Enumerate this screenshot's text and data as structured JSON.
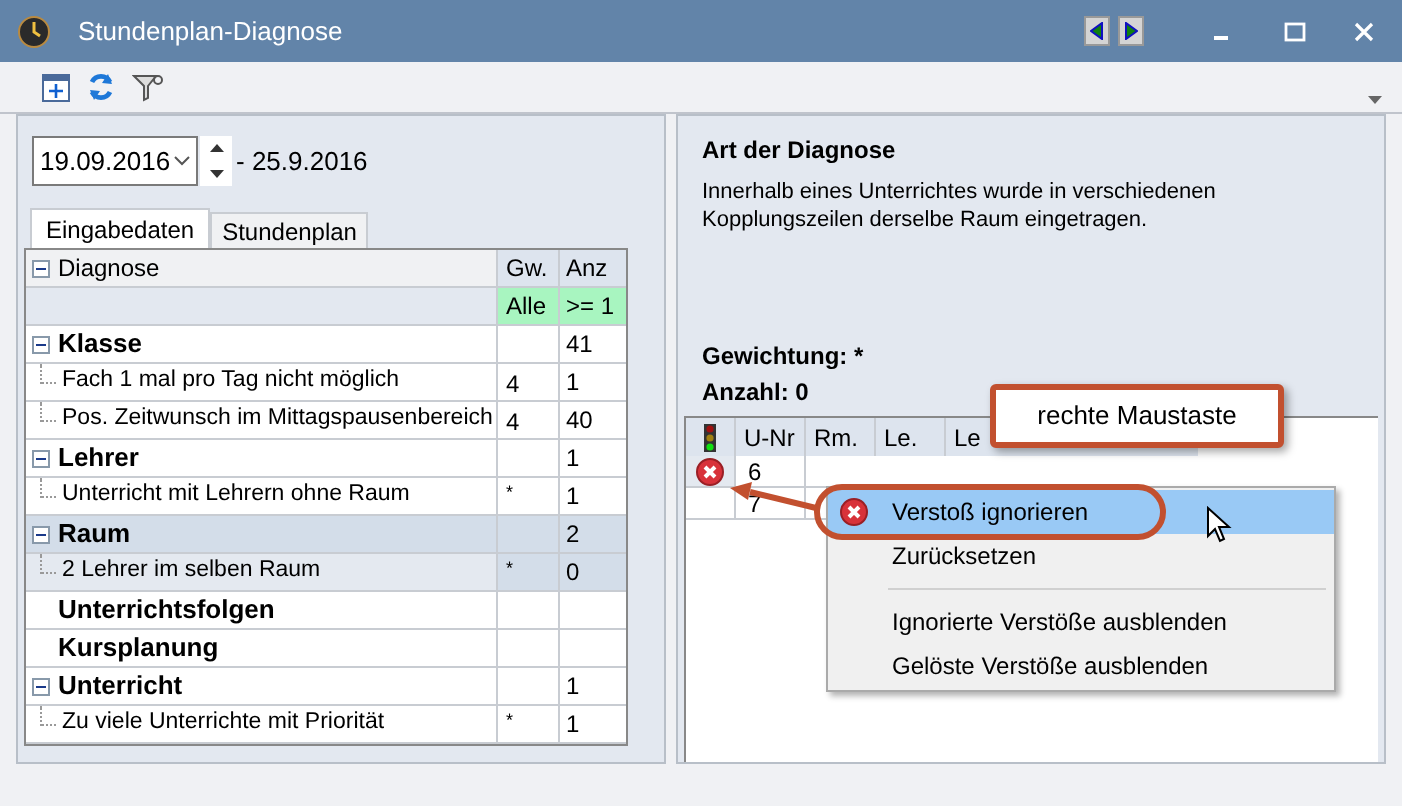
{
  "window": {
    "title": "Stundenplan-Diagnose"
  },
  "date": {
    "value": "19.09.2016",
    "range_end": "- 25.9.2016"
  },
  "tabs": [
    {
      "label": "Eingabedaten",
      "selected": true
    },
    {
      "label": "Stundenplan",
      "selected": false
    }
  ],
  "diagnosis_table": {
    "columns": [
      "Diagnose",
      "Gw.",
      "Anz"
    ],
    "filter": {
      "gw": "Alle",
      "anz": ">= 1"
    },
    "groups": [
      {
        "label": "Klasse",
        "anz": "41",
        "expanded": true,
        "selected": false,
        "children": [
          {
            "label": "Fach 1 mal pro Tag nicht möglich",
            "gw": "4",
            "anz": "1",
            "selected": false
          },
          {
            "label": "Pos. Zeitwunsch im Mittagspausenbereich",
            "gw": "4",
            "anz": "40",
            "selected": false
          }
        ]
      },
      {
        "label": "Lehrer",
        "anz": "1",
        "expanded": true,
        "selected": false,
        "children": [
          {
            "label": "Unterricht mit Lehrern ohne Raum",
            "gw": "*",
            "anz": "1",
            "selected": false
          }
        ]
      },
      {
        "label": "Raum",
        "anz": "2",
        "expanded": true,
        "selected": true,
        "children": [
          {
            "label": "2 Lehrer im selben Raum",
            "gw": "*",
            "anz": "0",
            "selected": true
          }
        ]
      },
      {
        "label": "Unterrichtsfolgen",
        "selected": false
      },
      {
        "label": "Kursplanung",
        "selected": false
      },
      {
        "label": "Unterricht",
        "anz": "1",
        "expanded": true,
        "selected": false,
        "children": [
          {
            "label": "Zu viele Unterrichte mit Priorität",
            "gw": "*",
            "anz": "1",
            "selected": false
          }
        ]
      }
    ]
  },
  "details": {
    "title": "Art der Diagnose",
    "text": "Innerhalb eines Unterrichtes wurde in verschiedenen Kopplungszeilen derselbe Raum eingetragen.",
    "weighting": "Gewichtung: *",
    "count": "Anzahl: 0"
  },
  "violations": {
    "columns": [
      "U-Nr",
      "Rm.",
      "Le.",
      "Le"
    ],
    "rows": [
      {
        "kind": "error",
        "u_nr": "6"
      },
      {
        "kind": "plain",
        "u_nr": "7"
      }
    ]
  },
  "context_menu": [
    {
      "kind": "icon_item",
      "label": "Verstoß ignorieren",
      "selected": true
    },
    {
      "kind": "item",
      "label": "Zurücksetzen",
      "selected": false
    },
    {
      "kind": "separator"
    },
    {
      "kind": "item",
      "label": "Ignorierte Verstöße ausblenden",
      "selected": false
    },
    {
      "kind": "item",
      "label": "Gelöste Verstöße ausblenden",
      "selected": false
    }
  ],
  "callout": "rechte Maustaste"
}
